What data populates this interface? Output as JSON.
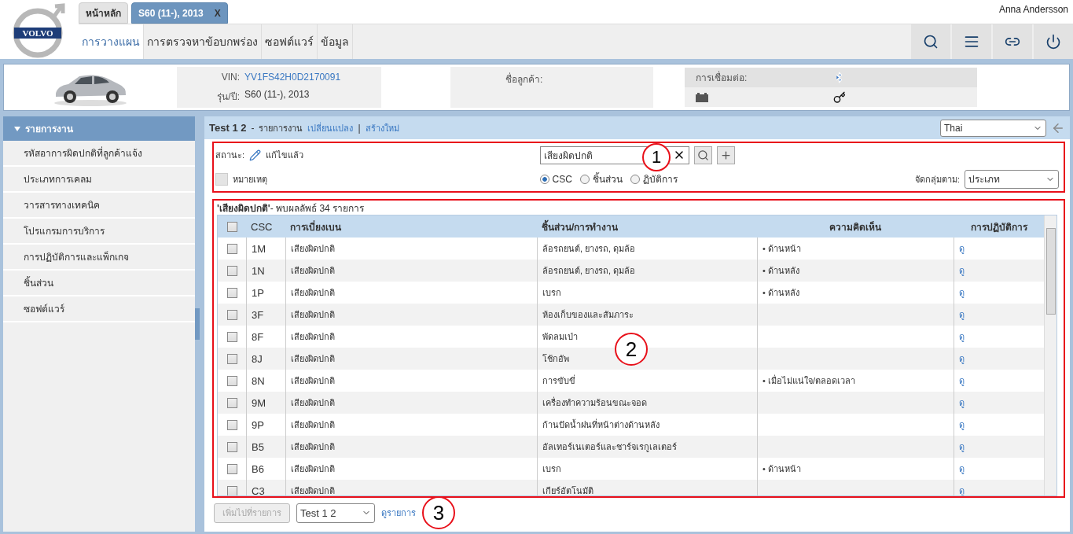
{
  "logo": {
    "text": "VOLVO"
  },
  "user": "Anna Andersson",
  "tabs": [
    {
      "label": "หน้าหลัก",
      "selected": false
    },
    {
      "label": "S60 (11-), 2013",
      "selected": true,
      "close": "X"
    }
  ],
  "nav": [
    {
      "label": "การวางแผน",
      "selected": true
    },
    {
      "label": "การตรวจหาข้อบกพร่อง",
      "selected": false
    },
    {
      "label": "ซอฟต์แวร์",
      "selected": false
    },
    {
      "label": "ข้อมูล",
      "selected": false
    }
  ],
  "toolbar": [
    {
      "kind": "search"
    },
    {
      "kind": "menu"
    },
    {
      "kind": "link"
    },
    {
      "kind": "power"
    }
  ],
  "vehicle": {
    "vin_label": "VIN:",
    "vin": "YV1FS42H0D2170091",
    "model_label": "รุ่น/ปี:",
    "model": "S60 (11-), 2013",
    "customer_label": "ชื่อลูกค้า:",
    "connection_label": "การเชื่อมต่อ:"
  },
  "sidebar": {
    "header": {
      "label": "รายการงาน",
      "expanded": true
    },
    "items": [
      {
        "label": "รหัสอาการผิดปกติที่ลูกค้าแจ้ง"
      },
      {
        "label": "ประเภทการเคลม"
      },
      {
        "label": "วารสารทางเทคนิค"
      },
      {
        "label": "โปรแกรมการบริการ"
      },
      {
        "label": "การปฏิบัติการและแพ็กเกจ"
      },
      {
        "label": "ชิ้นส่วน"
      },
      {
        "label": "ซอฟต์แวร์"
      }
    ]
  },
  "worklist": {
    "name": "Test 1 2",
    "sep": "-",
    "title": "รายการงาน",
    "links": [
      {
        "label": "เปลี่ยนแปลง"
      },
      {
        "label": "สร้างใหม่"
      }
    ],
    "divider": "|",
    "language": "Thai"
  },
  "filter": {
    "status_label": "สถานะ:",
    "status": "แก้ไขแล้ว",
    "note": "หมายเหตุ",
    "search": "เสียงผิดปกติ",
    "group_label": "จัดกลุ่มตาม:",
    "group": "ประเภท",
    "radios": [
      {
        "label": "CSC",
        "selected": true
      },
      {
        "label": "ชิ้นส่วน",
        "selected": false
      },
      {
        "label": "ฏิบัติการ",
        "selected": false
      }
    ]
  },
  "results": {
    "query": "'เสียงผิดปกติ'",
    "summary": "- พบผลลัพธ์ 34 รายการ"
  },
  "table": {
    "all_checked": false,
    "columns": [
      "CSC",
      "การเบี่ยงเบน",
      "ชิ้นส่วน/การทำงาน",
      "ความคิดเห็น",
      "การปฏิบัติการ"
    ],
    "rows": [
      {
        "checked": false,
        "csc": "1M",
        "deviation": "เสียงผิดปกติ",
        "component": "ล้อรถยนต์, ยางรถ, ดุมล้อ",
        "comment": "• ด้านหน้า",
        "action": "ดู"
      },
      {
        "checked": false,
        "csc": "1N",
        "deviation": "เสียงผิดปกติ",
        "component": "ล้อรถยนต์, ยางรถ, ดุมล้อ",
        "comment": "• ด้านหลัง",
        "action": "ดู"
      },
      {
        "checked": false,
        "csc": "1P",
        "deviation": "เสียงผิดปกติ",
        "component": "เบรก",
        "comment": "• ด้านหลัง",
        "action": "ดู"
      },
      {
        "checked": false,
        "csc": "3F",
        "deviation": "เสียงผิดปกติ",
        "component": "ห้องเก็บของและสัมภาระ",
        "action": "ดู"
      },
      {
        "checked": false,
        "csc": "8F",
        "deviation": "เสียงผิดปกติ",
        "component": "พัดลมเป่า",
        "action": "ดู"
      },
      {
        "checked": false,
        "csc": "8J",
        "deviation": "เสียงผิดปกติ",
        "component": "โช้กอัพ",
        "action": "ดู"
      },
      {
        "checked": false,
        "csc": "8N",
        "deviation": "เสียงผิดปกติ",
        "component": "การขับขี่",
        "comment": "• เมื่อไม่แน่ใจ/ตลอดเวลา",
        "action": "ดู"
      },
      {
        "checked": false,
        "csc": "9M",
        "deviation": "เสียงผิดปกติ",
        "component": "เครื่องทำความร้อนขณะจอด",
        "action": "ดู"
      },
      {
        "checked": false,
        "csc": "9P",
        "deviation": "เสียงผิดปกติ",
        "component": "ก้านปัดน้ำฝนที่หน้าต่างด้านหลัง",
        "action": "ดู"
      },
      {
        "checked": false,
        "csc": "B5",
        "deviation": "เสียงผิดปกติ",
        "component": "อัลเทอร์เนเตอร์และชาร์จเรกูเลเตอร์",
        "action": "ดู"
      },
      {
        "checked": false,
        "csc": "B6",
        "deviation": "เสียงผิดปกติ",
        "component": "เบรก",
        "comment": "• ด้านหน้า",
        "action": "ดู"
      },
      {
        "checked": false,
        "csc": "C3",
        "deviation": "เสียงผิดปกติ",
        "component": "เกียร์อัตโนมัติ",
        "action": "ดู"
      }
    ]
  },
  "footer": {
    "add_button": {
      "label": "เพิ่มไปที่รายการ",
      "disabled": true
    },
    "list_select": "Test 1 2",
    "view_link": "ดูรายการ"
  },
  "callouts": [
    "1",
    "2",
    "3"
  ]
}
